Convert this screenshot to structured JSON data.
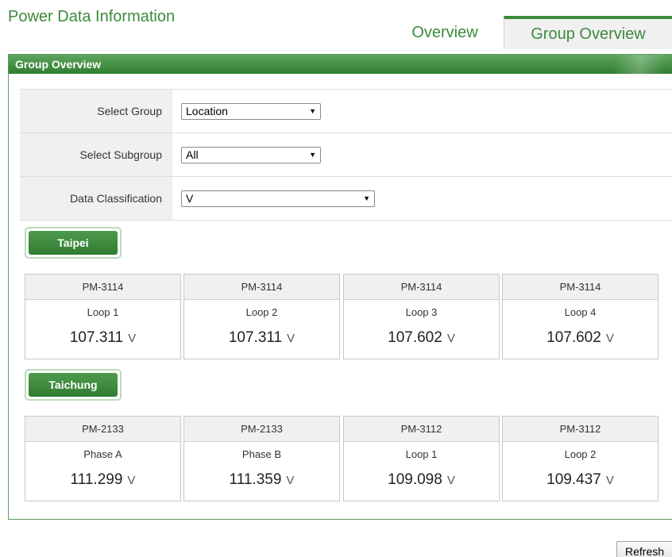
{
  "page": {
    "title": "Power Data Information"
  },
  "tabs": [
    {
      "label": "Overview"
    },
    {
      "label": "Group Overview"
    }
  ],
  "panel": {
    "title": "Group Overview"
  },
  "form": {
    "group": {
      "label": "Select Group",
      "value": "Location"
    },
    "subgroup": {
      "label": "Select Subgroup",
      "value": "All"
    },
    "classification": {
      "label": "Data Classification",
      "value": "V"
    },
    "dropdown_icon": "triangle-down"
  },
  "groups": [
    {
      "name": "Taipei",
      "cards": [
        {
          "model": "PM-3114",
          "channel": "Loop 1",
          "value": "107.311",
          "unit": "V"
        },
        {
          "model": "PM-3114",
          "channel": "Loop 2",
          "value": "107.311",
          "unit": "V"
        },
        {
          "model": "PM-3114",
          "channel": "Loop 3",
          "value": "107.602",
          "unit": "V"
        },
        {
          "model": "PM-3114",
          "channel": "Loop 4",
          "value": "107.602",
          "unit": "V"
        }
      ]
    },
    {
      "name": "Taichung",
      "cards": [
        {
          "model": "PM-2133",
          "channel": "Phase A",
          "value": "111.299",
          "unit": "V"
        },
        {
          "model": "PM-2133",
          "channel": "Phase B",
          "value": "111.359",
          "unit": "V"
        },
        {
          "model": "PM-3112",
          "channel": "Loop 1",
          "value": "109.098",
          "unit": "V"
        },
        {
          "model": "PM-3112",
          "channel": "Loop 2",
          "value": "109.437",
          "unit": "V"
        }
      ]
    }
  ],
  "actions": {
    "refresh_label": "Refresh"
  },
  "colors": {
    "accent": "#3d8a3d",
    "header_dark": "#2f7d32",
    "header_light": "#5ea55e"
  }
}
